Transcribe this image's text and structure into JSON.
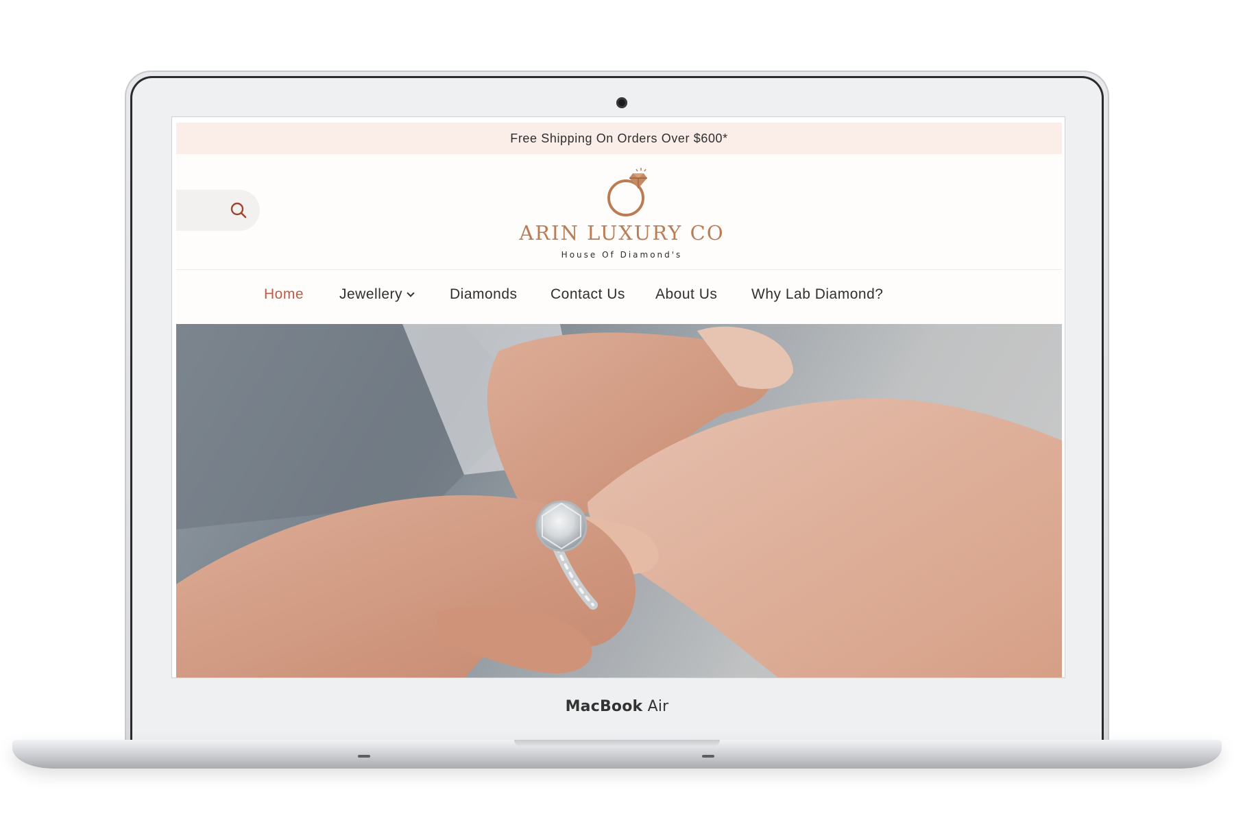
{
  "announcement": {
    "text": "Free Shipping On Orders Over $600*"
  },
  "header": {
    "search_icon": "search-icon",
    "logo": {
      "name": "ARIN LUXURY CO",
      "tagline": "House Of Diamond's",
      "icon": "diamond-ring-icon"
    }
  },
  "nav": {
    "items": [
      {
        "label": "Home",
        "active": true
      },
      {
        "label": "Jewellery",
        "has_dropdown": true
      },
      {
        "label": "Diamonds"
      },
      {
        "label": "Contact Us"
      },
      {
        "label": "About Us"
      },
      {
        "label": "Why Lab Diamond?"
      }
    ]
  },
  "device": {
    "label_bold": "MacBook",
    "label_regular": " Air"
  },
  "colors": {
    "accent": "#bf5b45",
    "announcement_bg": "#fbeee8",
    "logo": "#b97c55"
  }
}
